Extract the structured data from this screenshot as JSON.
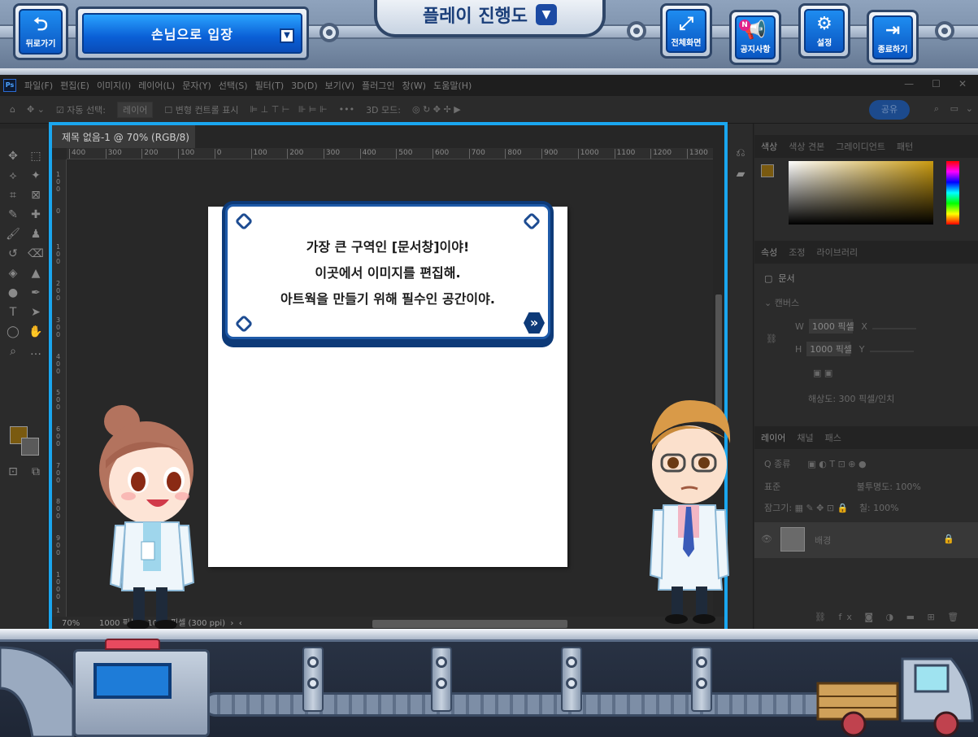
{
  "hud": {
    "back_label": "뒤로가기",
    "guest_label": "손님으로 입장",
    "progress_label": "플레이 진행도",
    "fullscreen_label": "전체화면",
    "notice_label": "공지사항",
    "notice_badge": "N",
    "settings_label": "설정",
    "exit_label": "종료하기"
  },
  "ps": {
    "menu": [
      "파일(F)",
      "편집(E)",
      "이미지(I)",
      "레이어(L)",
      "문자(Y)",
      "선택(S)",
      "필터(T)",
      "3D(D)",
      "보기(V)",
      "플러그인",
      "창(W)",
      "도움말(H)"
    ],
    "options": {
      "auto_select": "자동 선택:",
      "auto_select_value": "레이어",
      "transform_controls": "변형 컨트롤 표시",
      "mode_3d": "3D 모드:",
      "share": "공유"
    },
    "doc_tab_title": "제목 없음-1 @ 70% (RGB/8)",
    "ruler_h": [
      "400",
      "300",
      "200",
      "100",
      "0",
      "100",
      "200",
      "300",
      "400",
      "500",
      "600",
      "700",
      "800",
      "900",
      "1000",
      "1100",
      "1200",
      "1300"
    ],
    "ruler_v": [
      "100",
      "0",
      "100",
      "200",
      "300",
      "400",
      "500",
      "600",
      "700",
      "800",
      "900",
      "1000",
      "1"
    ],
    "status_zoom": "70%",
    "status_info": "1000 픽셀 x 1000 픽셀 (300 ppi)",
    "panel": {
      "color_tabs": [
        "색상",
        "색상 견본",
        "그레이디언트",
        "패턴"
      ],
      "props_tabs": [
        "속성",
        "조정",
        "라이브러리"
      ],
      "doc_label": "문서",
      "canvas_label": "캔버스",
      "w_label": "W",
      "w_value": "1000 픽셀",
      "h_label": "H",
      "h_value": "1000 픽셀",
      "x_label": "X",
      "y_label": "Y",
      "resolution": "해상도: 300 픽셀/인치",
      "layer_tabs": [
        "레이어",
        "채널",
        "패스"
      ],
      "layer_search": "Q 종류",
      "blend_mode": "표준",
      "opacity": "불투명도: 100%",
      "lock": "잠그기:",
      "fill": "칠: 100%",
      "layer_name": "배경"
    }
  },
  "dialog": {
    "lines": [
      "가장 큰 구역인 [문서창]이야!",
      "이곳에서 이미지를 편집해.",
      "아트웍을 만들기 위해 필수인 공간이야."
    ]
  },
  "colors": {
    "accent_blue": "#0a5fd6",
    "frame_blue": "#1aa6ef",
    "foreground_swatch": "#7a5a10"
  }
}
